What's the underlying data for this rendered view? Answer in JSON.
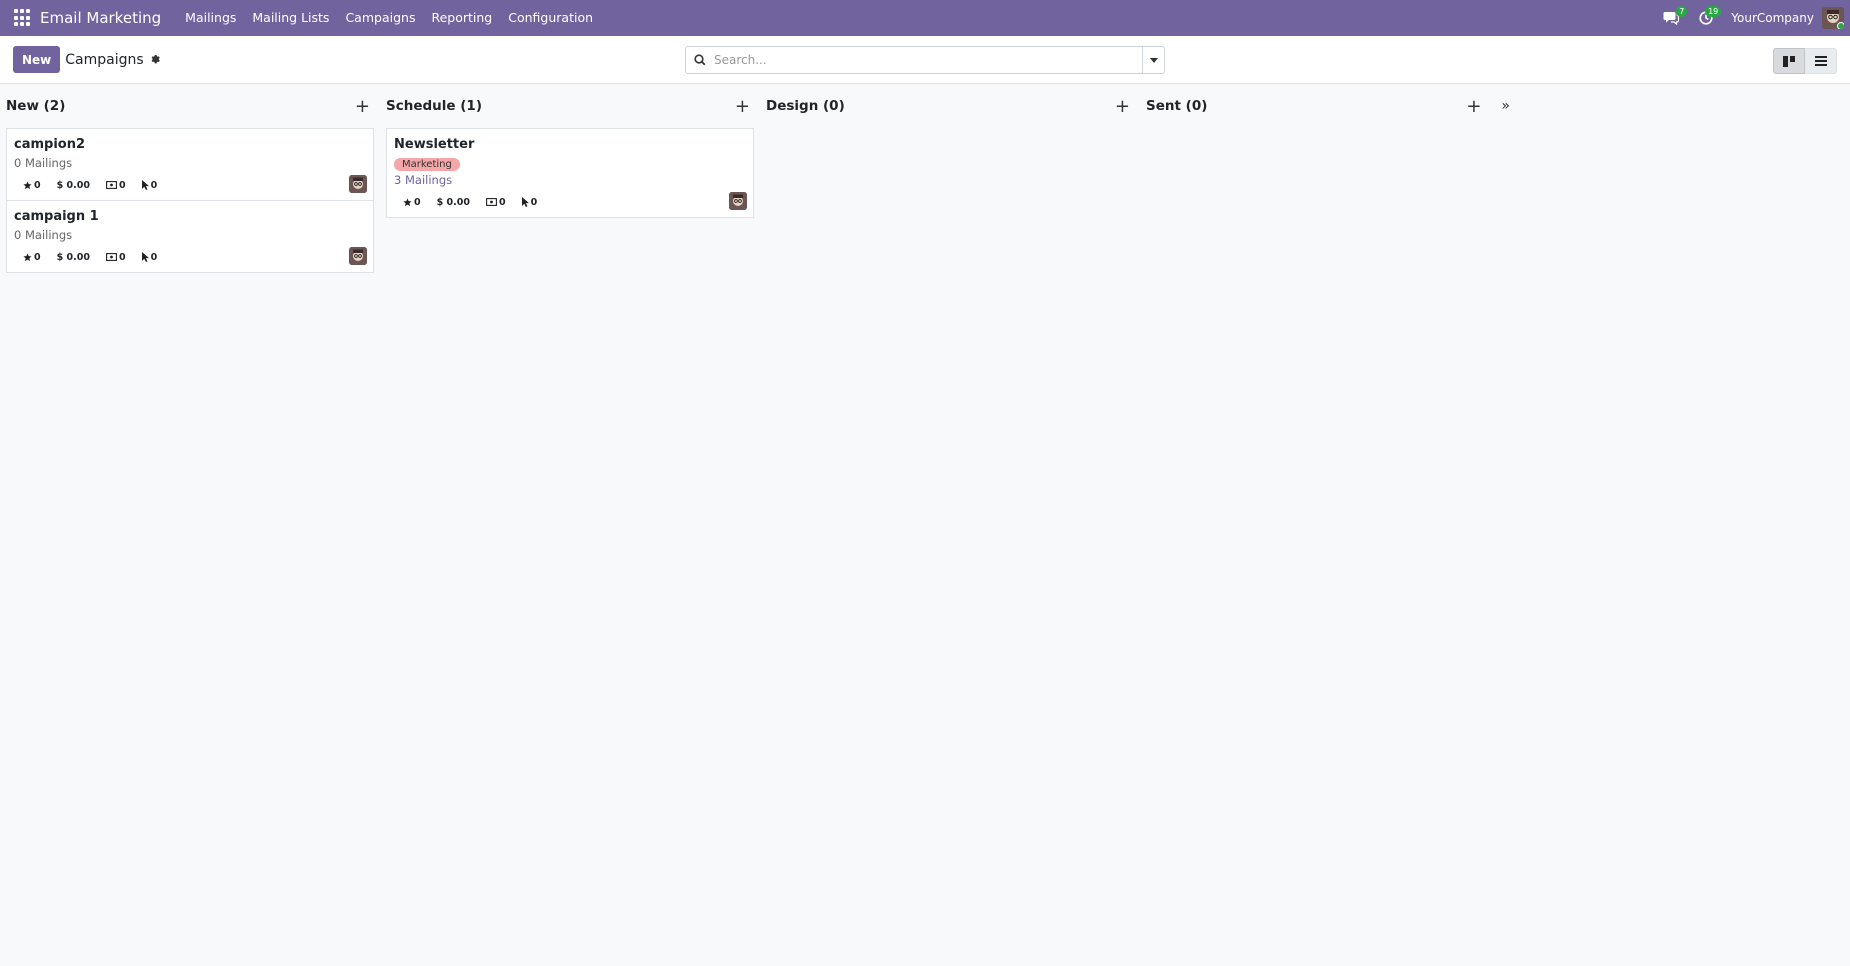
{
  "navbar": {
    "app_name": "Email Marketing",
    "menu": [
      "Mailings",
      "Mailing Lists",
      "Campaigns",
      "Reporting",
      "Configuration"
    ],
    "messages_count": "7",
    "activities_count": "19",
    "company": "YourCompany"
  },
  "control": {
    "new_label": "New",
    "breadcrumb": "Campaigns",
    "search_placeholder": "Search..."
  },
  "columns": [
    {
      "title": "New (2)",
      "cards": [
        {
          "title": "campion2",
          "tag": "",
          "mailings": "0 Mailings",
          "stats": [
            "0",
            "$ 0.00",
            "0",
            "0"
          ]
        },
        {
          "title": "campaign 1",
          "tag": "",
          "mailings": "0 Mailings",
          "stats": [
            "0",
            "$ 0.00",
            "0",
            "0"
          ]
        }
      ]
    },
    {
      "title": "Schedule (1)",
      "cards": [
        {
          "title": "Newsletter",
          "tag": "Marketing",
          "mailings": "3 Mailings",
          "stats": [
            "0",
            "$ 0.00",
            "0",
            "0"
          ]
        }
      ]
    },
    {
      "title": "Design (0)",
      "cards": []
    },
    {
      "title": "Sent (0)",
      "cards": []
    }
  ],
  "colors": {
    "brand": "#71639e",
    "tag_marketing": "#f4a6a9",
    "online": "#28a745"
  },
  "icons": {
    "apps": "grid-icon",
    "messages": "chat-icon",
    "activities": "clock-icon",
    "gear": "gear-icon",
    "search": "search-icon"
  }
}
